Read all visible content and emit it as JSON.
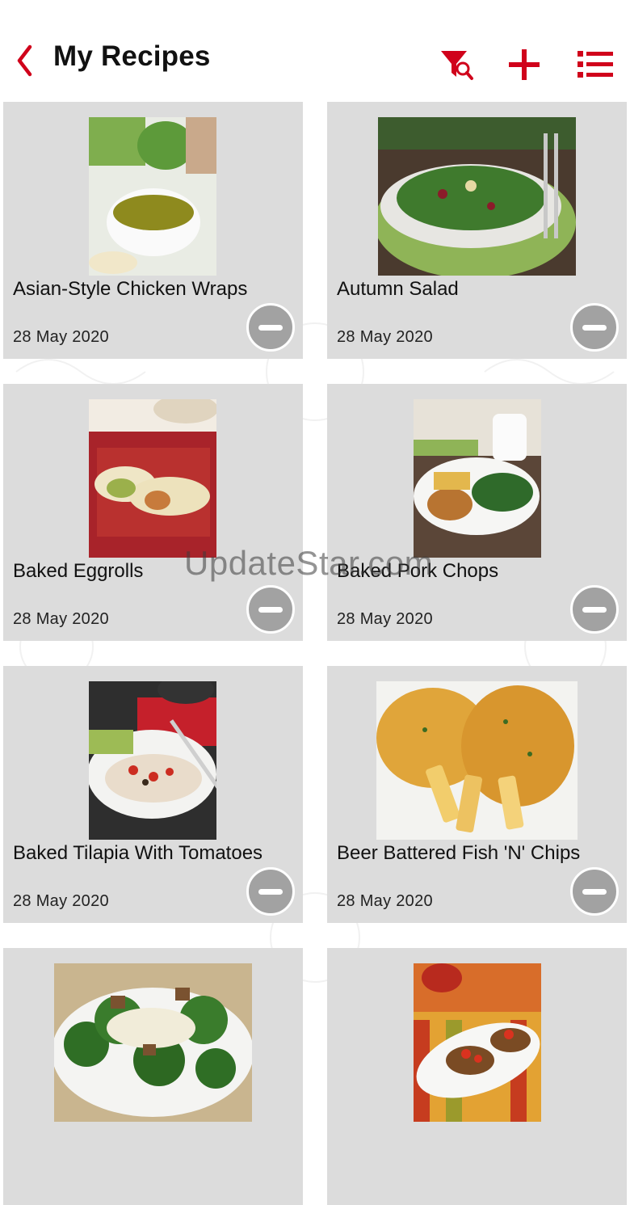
{
  "header": {
    "title": "My Recipes",
    "accent_color": "#d0021b"
  },
  "recipes": [
    {
      "name": "Asian-Style Chicken Wraps",
      "date": "28 May 2020"
    },
    {
      "name": "Autumn Salad",
      "date": "28 May 2020"
    },
    {
      "name": "Baked Eggrolls",
      "date": "28 May 2020"
    },
    {
      "name": "Baked Pork Chops",
      "date": "28 May 2020"
    },
    {
      "name": "Baked Tilapia With Tomatoes",
      "date": "28 May 2020"
    },
    {
      "name": "Beer Battered Fish 'N' Chips",
      "date": "28 May 2020"
    },
    {
      "name": "",
      "date": ""
    },
    {
      "name": "",
      "date": ""
    }
  ],
  "watermark": "UpdateStar.com",
  "icons": {
    "back": "chevron-left-icon",
    "filter": "filter-search-icon",
    "add": "plus-icon",
    "list_view": "list-view-icon",
    "remove": "minus-circle-icon"
  }
}
